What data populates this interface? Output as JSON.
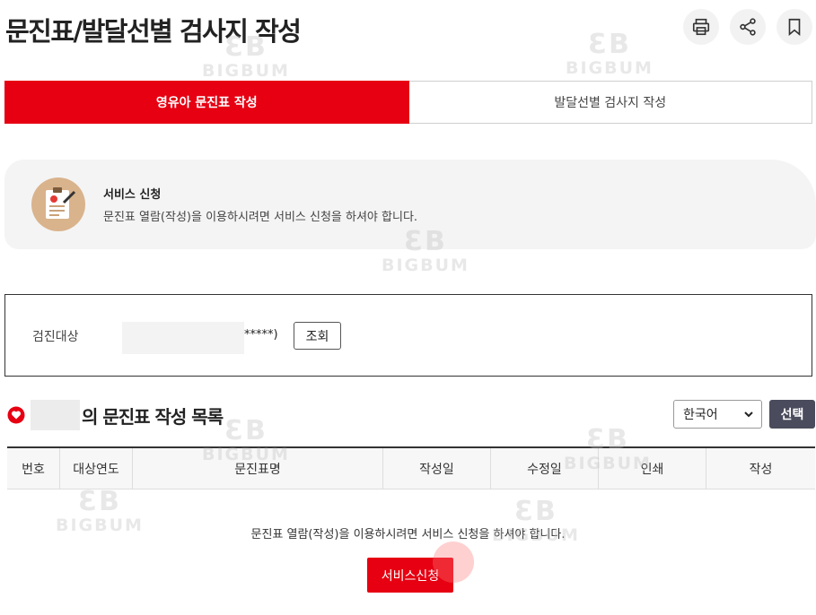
{
  "page": {
    "title": "문진표/발달선별 검사지 작성"
  },
  "header_actions": [
    {
      "icon": "printer-icon"
    },
    {
      "icon": "share-icon"
    },
    {
      "icon": "bookmark-icon"
    }
  ],
  "tabs": [
    {
      "label": "영유아 문진표 작성",
      "active": true
    },
    {
      "label": "발달선별 검사지 작성",
      "active": false
    }
  ],
  "notice": {
    "title": "서비스 신청",
    "description": "문진표 열람(작성)을 이용하시려면 서비스 신청을 하셔야 합니다."
  },
  "search": {
    "label": "검진대상",
    "masked_suffix": "*****)",
    "lookup_label": "조회"
  },
  "list": {
    "heading_suffix": "의 문진표 작성 목록",
    "language_selected": "한국어",
    "select_button_label": "선택",
    "columns": [
      "번호",
      "대상연도",
      "문진표명",
      "작성일",
      "수정일",
      "인쇄",
      "작성"
    ],
    "empty_message": "문진표 열람(작성)을 이용하시려면 서비스 신청을 하셔야 합니다.",
    "apply_button_label": "서비스신청"
  },
  "watermark": {
    "mark": "ƐB",
    "text": "BIGBUM"
  },
  "colors": {
    "accent_red": "#e60012",
    "dark_button": "#4a4b5c",
    "panel_gray": "#f4f4f4"
  }
}
